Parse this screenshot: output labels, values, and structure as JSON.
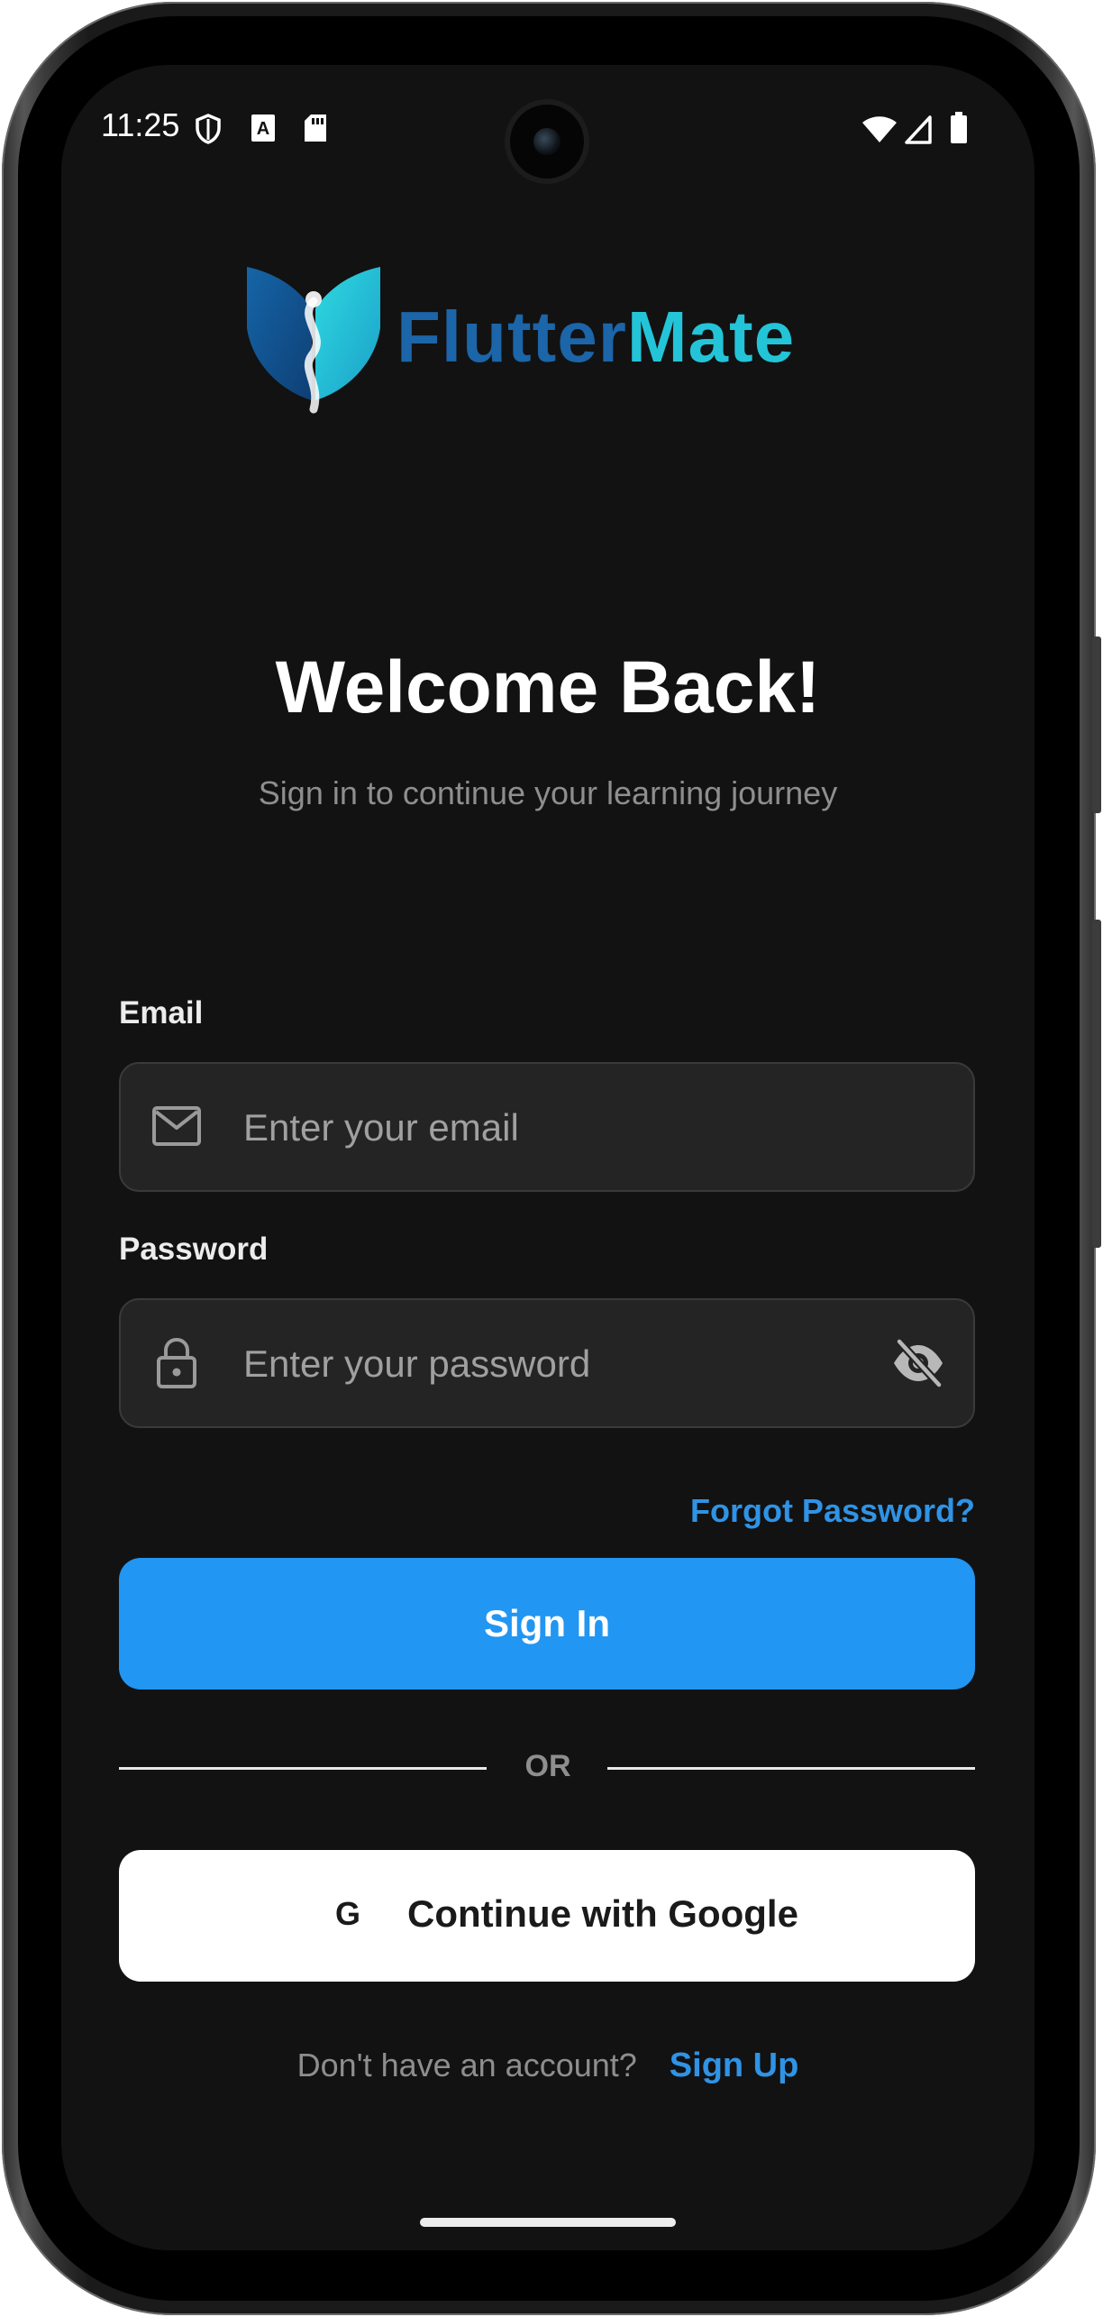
{
  "status_bar": {
    "time": "11:25",
    "left_icons": [
      "shield-icon",
      "font-a-icon",
      "sd-card-icon"
    ],
    "right_icons": [
      "wifi-icon",
      "signal-icon",
      "battery-icon"
    ]
  },
  "brand": {
    "name_part1": "Flutter",
    "name_part2": "Mate",
    "colors": {
      "primary": "#1b65a8",
      "accent": "#23c4d8"
    }
  },
  "header": {
    "title": "Welcome Back!",
    "subtitle": "Sign in to continue your learning journey"
  },
  "form": {
    "email": {
      "label": "Email",
      "placeholder": "Enter your email",
      "value": "",
      "icon": "mail-icon"
    },
    "password": {
      "label": "Password",
      "placeholder": "Enter your password",
      "value": "",
      "icon": "lock-icon",
      "toggle_icon": "eye-off-icon"
    },
    "forgot_label": "Forgot Password?",
    "submit_label": "Sign In"
  },
  "divider": {
    "label": "OR"
  },
  "social": {
    "google_label": "Continue with Google",
    "google_icon_text": "G"
  },
  "footer": {
    "question": "Don't have an account?",
    "signup_label": "Sign Up"
  },
  "colors": {
    "background": "#121212",
    "primary_button": "#2196f3",
    "link": "#2f93e6"
  }
}
